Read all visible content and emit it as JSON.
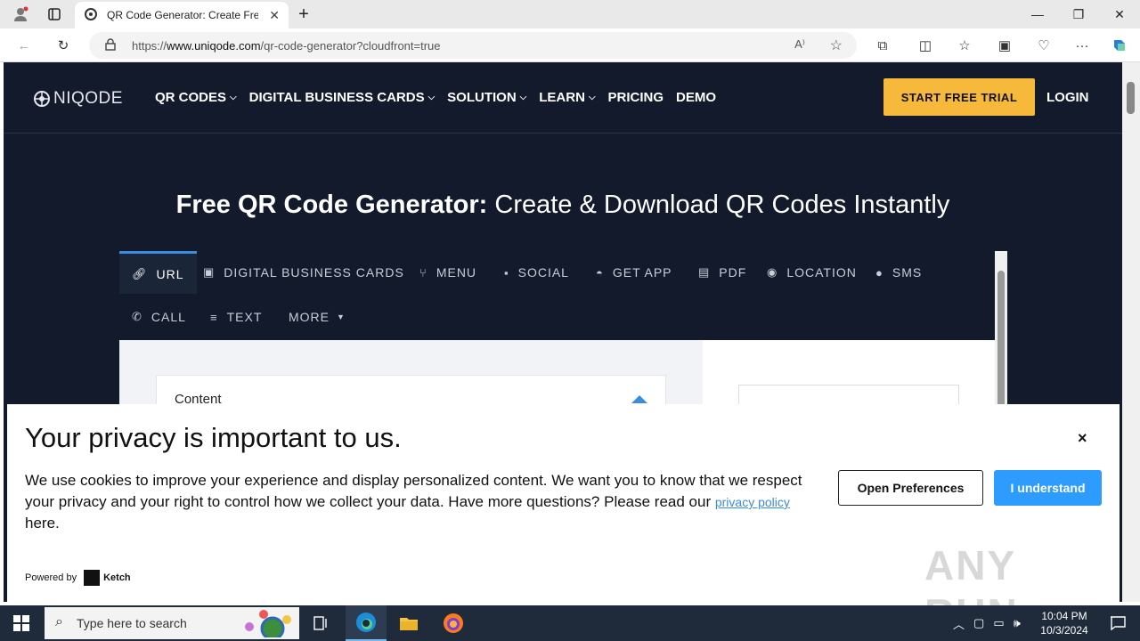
{
  "browser": {
    "tab_title": "QR Code Generator: Create Free QR Codes",
    "url_prefix": "https://",
    "url_domain": "www.uniqode.com",
    "url_path": "/qr-code-generator?cloudfront=true"
  },
  "site": {
    "logo_text": "NIQODE",
    "menu": [
      {
        "label": "QR CODES",
        "has_dropdown": true
      },
      {
        "label": "DIGITAL BUSINESS CARDS",
        "has_dropdown": true
      },
      {
        "label": "SOLUTION",
        "has_dropdown": true
      },
      {
        "label": "LEARN",
        "has_dropdown": true
      },
      {
        "label": "PRICING",
        "has_dropdown": false
      },
      {
        "label": "DEMO",
        "has_dropdown": false
      }
    ],
    "trial_label": "START FREE TRIAL",
    "login_label": "LOGIN",
    "hero_bold": "Free QR Code Generator:",
    "hero_light": " Create & Download QR Codes Instantly",
    "tabs": [
      {
        "label": "URL",
        "icon": "link-icon",
        "active": true
      },
      {
        "label": "DIGITAL BUSINESS CARDS",
        "icon": "contact-card-icon"
      },
      {
        "label": "MENU",
        "icon": "fork-knife-icon"
      },
      {
        "label": "SOCIAL",
        "icon": "facebook-icon"
      },
      {
        "label": "GET APP",
        "icon": "android-icon"
      },
      {
        "label": "PDF",
        "icon": "pdf-icon"
      },
      {
        "label": "LOCATION",
        "icon": "map-pin-icon"
      },
      {
        "label": "SMS",
        "icon": "chat-icon"
      },
      {
        "label": "CALL",
        "icon": "phone-icon"
      },
      {
        "label": "TEXT",
        "icon": "text-icon"
      },
      {
        "label": "MORE",
        "icon": "caret-down-icon"
      }
    ],
    "content_label": "Content"
  },
  "cookie": {
    "title": "Your privacy is important to us.",
    "body": "We use cookies to improve your experience and display personalized content. We want you to know that we respect your privacy and your right to control how we collect your data. Have more questions? Please read our ",
    "link": "privacy policy",
    "body_end": " here.",
    "pref_label": "Open Preferences",
    "ok_label": "I understand",
    "close": "×",
    "powered_by": "Powered by",
    "brand": "Ketch"
  },
  "watermark": "ANY RUN",
  "taskbar": {
    "search_placeholder": "Type here to search",
    "time": "10:04 PM",
    "date": "10/3/2024"
  },
  "colors": {
    "site_bg": "#121a2c",
    "accent_yellow": "#f6b93b",
    "accent_blue": "#2e9bff"
  }
}
